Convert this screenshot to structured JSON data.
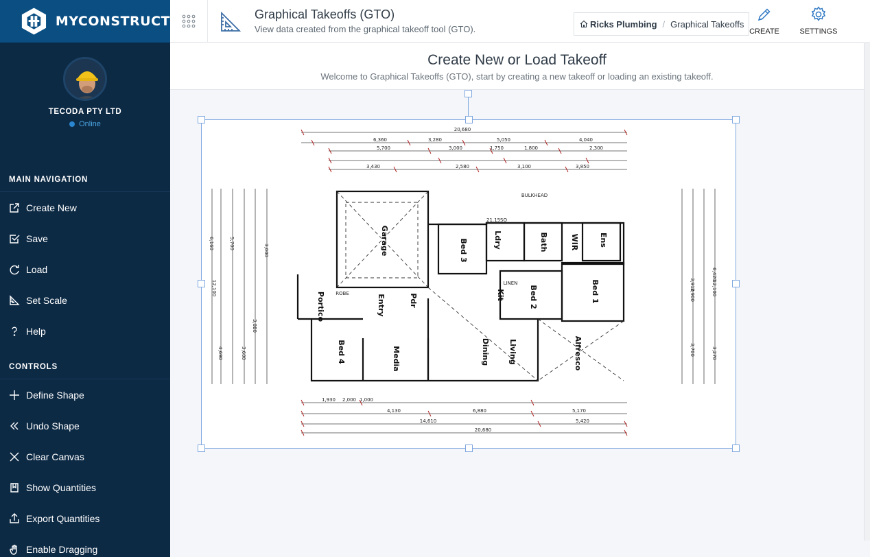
{
  "brand": {
    "name": "MYCONSTRUCT"
  },
  "profile": {
    "company": "TECODA PTY LTD",
    "status": "Online"
  },
  "nav": {
    "main_title": "MAIN NAVIGATION",
    "main_items": [
      {
        "label": "Create New",
        "icon": "external-link-icon"
      },
      {
        "label": "Save",
        "icon": "checkbox-icon"
      },
      {
        "label": "Load",
        "icon": "refresh-icon"
      },
      {
        "label": "Set Scale",
        "icon": "set-square-icon"
      },
      {
        "label": "Help",
        "icon": "question-icon"
      }
    ],
    "controls_title": "CONTROLS",
    "control_items": [
      {
        "label": "Define Shape",
        "icon": "plus-icon"
      },
      {
        "label": "Undo Shape",
        "icon": "double-chevron-left-icon"
      },
      {
        "label": "Clear Canvas",
        "icon": "close-icon"
      },
      {
        "label": "Show Quantities",
        "icon": "book-icon"
      },
      {
        "label": "Export Quantities",
        "icon": "upload-icon"
      },
      {
        "label": "Enable Dragging",
        "icon": "hand-icon"
      }
    ]
  },
  "header": {
    "title": "Graphical Takeoffs (GTO)",
    "subtitle": "View data created from the graphical takeoff tool (GTO).",
    "breadcrumb": {
      "home": "Ricks Plumbing",
      "current": "Graphical Takeoffs"
    },
    "create_label": "CREATE",
    "settings_label": "SETTINGS"
  },
  "content": {
    "title": "Create New or Load Takeoff",
    "subtitle": "Welcome to Graphical Takeoffs (GTO), start by creating a new takeoff or loading an existing takeoff."
  },
  "floorplan": {
    "dims_top": [
      "20,680",
      "6,360",
      "3,280",
      "5,050",
      "4,040",
      "5,700",
      "3,000",
      "1,750",
      "1,800",
      "2,300",
      "3,430",
      "2,580",
      "3,100",
      "3,850"
    ],
    "dims_bottom": [
      "1,930",
      "2,000",
      "1,000",
      "4,130",
      "6,880",
      "14,610",
      "20,680",
      "5,170",
      "5,420"
    ],
    "dims_left": [
      "6,160",
      "5,700",
      "12,100",
      "4,690",
      "3,600",
      "3,880",
      "3,000"
    ],
    "dims_right": [
      "6,420",
      "3,910",
      "2,900",
      "12,100",
      "3,700",
      "3,270"
    ],
    "rooms": [
      "Garage",
      "Bed 3",
      "Bed 1",
      "Bed 2",
      "Bed 4",
      "Media",
      "Dining",
      "Living",
      "Entry",
      "Portico",
      "Kit",
      "Ens",
      "WIR",
      "Bath",
      "Ldry",
      "Alfresco",
      "Pdr"
    ],
    "labels": [
      "BULKHEAD",
      "ROBE",
      "LINEN",
      "21.15SO"
    ]
  }
}
